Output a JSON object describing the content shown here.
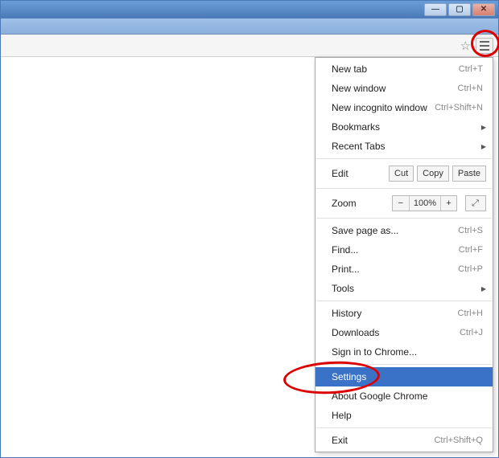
{
  "window_controls": {
    "min": "—",
    "max": "▢",
    "close": "✕"
  },
  "toolbar": {
    "star": "☆"
  },
  "menu": {
    "new_tab": {
      "label": "New tab",
      "shortcut": "Ctrl+T"
    },
    "new_window": {
      "label": "New window",
      "shortcut": "Ctrl+N"
    },
    "incognito": {
      "label": "New incognito window",
      "shortcut": "Ctrl+Shift+N"
    },
    "bookmarks": {
      "label": "Bookmarks"
    },
    "recent_tabs": {
      "label": "Recent Tabs"
    },
    "edit": {
      "label": "Edit",
      "cut": "Cut",
      "copy": "Copy",
      "paste": "Paste"
    },
    "zoom": {
      "label": "Zoom",
      "minus": "−",
      "value": "100%",
      "plus": "+",
      "fullscreen": "⛶"
    },
    "save_page": {
      "label": "Save page as...",
      "shortcut": "Ctrl+S"
    },
    "find": {
      "label": "Find...",
      "shortcut": "Ctrl+F"
    },
    "print": {
      "label": "Print...",
      "shortcut": "Ctrl+P"
    },
    "tools": {
      "label": "Tools"
    },
    "history": {
      "label": "History",
      "shortcut": "Ctrl+H"
    },
    "downloads": {
      "label": "Downloads",
      "shortcut": "Ctrl+J"
    },
    "signin": {
      "label": "Sign in to Chrome..."
    },
    "settings": {
      "label": "Settings"
    },
    "about": {
      "label": "About Google Chrome"
    },
    "help": {
      "label": "Help"
    },
    "exit": {
      "label": "Exit",
      "shortcut": "Ctrl+Shift+Q"
    }
  }
}
